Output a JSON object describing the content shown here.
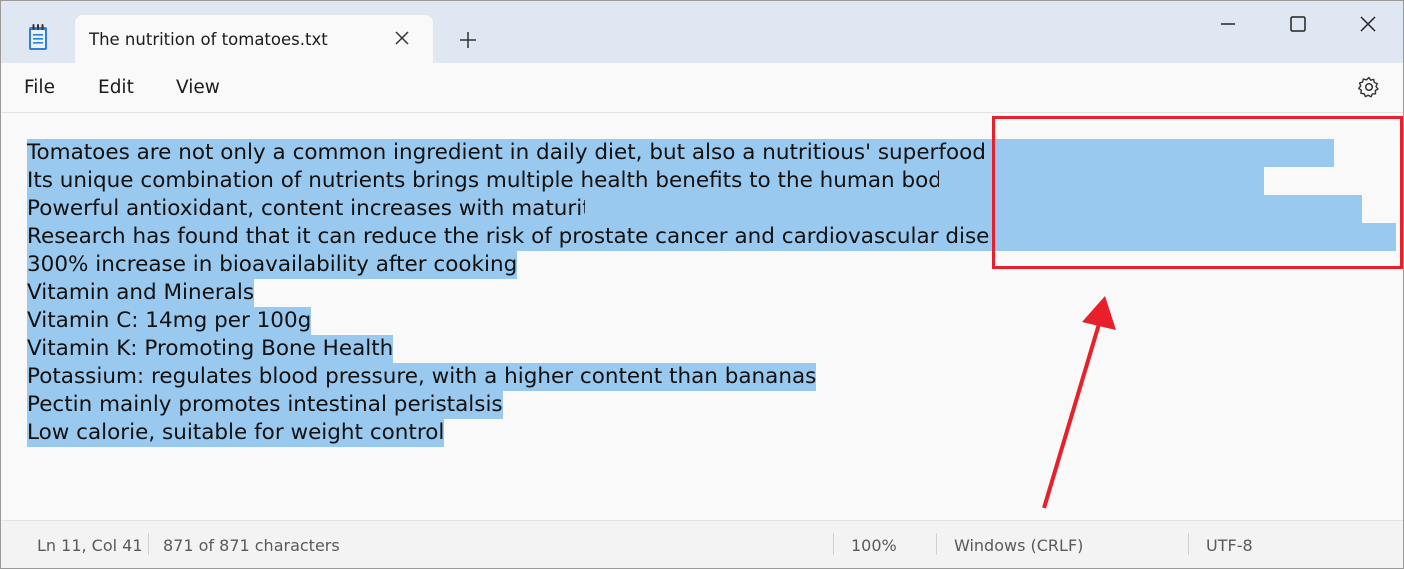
{
  "window": {
    "tab_title": "The nutrition of tomatoes.txt"
  },
  "menu": {
    "file": "File",
    "edit": "Edit",
    "view": "View"
  },
  "editor": {
    "lines": [
      "Tomatoes are not only a common ingredient in daily diet, but also a nutritious' superfood '.",
      "Its unique combination of nutrients brings multiple health benefits to the human body.",
      "Powerful antioxidant, content increases with maturity",
      "Research has found that it can reduce the risk of prostate cancer and cardiovascular disease",
      "300% increase in bioavailability after cooking",
      "Vitamin and Minerals",
      "Vitamin C: 14mg per 100g",
      "Vitamin K: Promoting Bone Health",
      "Potassium: regulates blood pressure, with a higher content than bananas",
      "Pectin mainly promotes intestinal peristalsis",
      "Low calorie, suitable for weight control"
    ],
    "selection_color": "#99c9ef"
  },
  "status": {
    "position": "Ln 11, Col 41",
    "characters": "871 of 871 characters",
    "zoom": "100%",
    "line_ending": "Windows (CRLF)",
    "encoding": "UTF-8"
  },
  "annotation": {
    "color": "#e8202b"
  },
  "icons": {
    "app": "notepad-icon",
    "tab_close": "close-icon",
    "new_tab": "plus-icon",
    "minimize": "minimize-icon",
    "maximize": "maximize-icon",
    "close": "close-icon",
    "settings": "gear-icon"
  }
}
